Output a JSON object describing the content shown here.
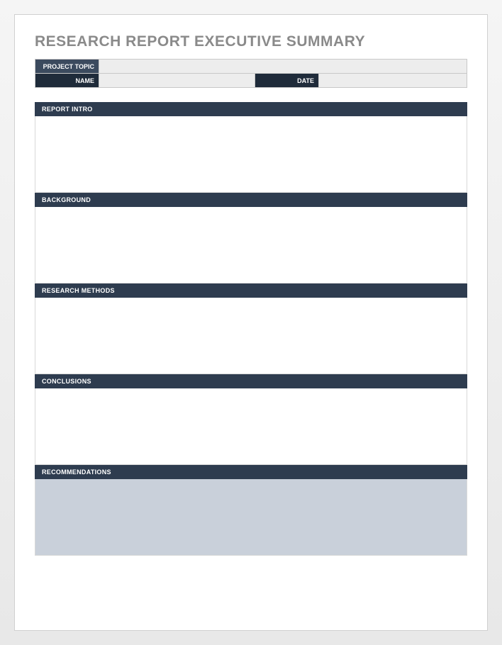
{
  "title": "RESEARCH REPORT EXECUTIVE SUMMARY",
  "header": {
    "project_topic_label": "PROJECT TOPIC",
    "project_topic_value": "",
    "name_label": "NAME",
    "name_value": "",
    "date_label": "DATE",
    "date_value": ""
  },
  "sections": {
    "report_intro": {
      "label": "REPORT INTRO",
      "content": ""
    },
    "background": {
      "label": "BACKGROUND",
      "content": ""
    },
    "research_methods": {
      "label": "RESEARCH METHODS",
      "content": ""
    },
    "conclusions": {
      "label": "CONCLUSIONS",
      "content": ""
    },
    "recommendations": {
      "label": "RECOMMENDATIONS",
      "content": ""
    }
  }
}
